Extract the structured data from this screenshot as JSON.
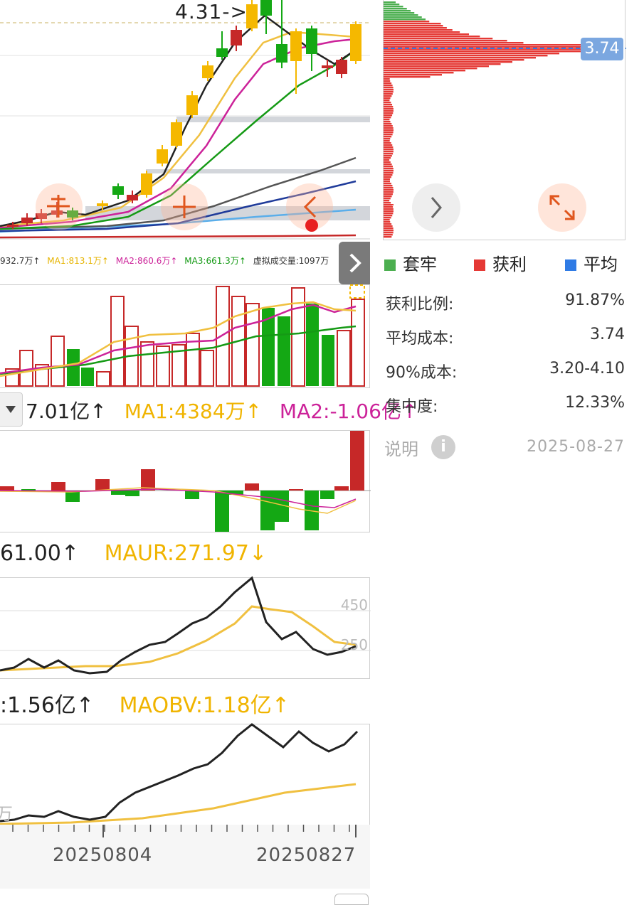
{
  "main_chart": {
    "price_marker": "4.31->",
    "ma_readout": {
      "vol": "932.7万↑",
      "ma1": "MA1:813.1万↑",
      "ma2": "MA2:860.6万↑",
      "ma3": "MA3:661.3万↑",
      "virtual": "虚拟成交量:1097万"
    }
  },
  "macd_panel": {
    "dropdown_icon": "caret-down-icon",
    "value": "7.01亿↑",
    "ma1": "MA1:4384万↑",
    "ma2": "MA2:-1.06亿↑"
  },
  "vr_panel": {
    "value": "61.00↑",
    "maur": "MAUR:271.97↓",
    "tick_450": "450",
    "tick_250": "250"
  },
  "obv_panel": {
    "value": ":1.56亿↑",
    "maobv": "MAOBV:1.18亿↑",
    "left_fragment": "万"
  },
  "x_axis": {
    "date1": "20250804",
    "date2": "20250827"
  },
  "chip_panel": {
    "avg_tag": "3.74",
    "legend": [
      {
        "label": "套牢",
        "color": "#4caf50"
      },
      {
        "label": "获利",
        "color": "#e53935"
      },
      {
        "label": "平均",
        "color": "#2f7be5"
      }
    ],
    "stats": [
      {
        "label": "获利比例:",
        "value": "91.87%"
      },
      {
        "label": "平均成本:",
        "value": "3.74"
      },
      {
        "label": "90%成本:",
        "value": "3.20-4.10"
      },
      {
        "label": "集中度:",
        "value": "12.33%"
      }
    ],
    "note_label": "说明",
    "note_icon": "info-icon",
    "date": "2025-08-27"
  },
  "controls": {
    "expand_panel_icon": "chevron-right-icon",
    "tool_icons": [
      "crosshair-icon",
      "plus-icon",
      "chevron-left-icon"
    ],
    "next_icon": "chevron-right-icon",
    "fullscreen_icon": "expand-icon"
  },
  "colors": {
    "up": "#c62828",
    "down": "#14a814",
    "yellow": "#f5b800",
    "ma_black": "#222222",
    "ma_yellow": "#f0c040",
    "ma_magenta": "#cc2299",
    "ma_green": "#159a15",
    "ma_gray": "#555555",
    "ma_navy": "#1f3b9a",
    "ma_lightblue": "#5aaeea",
    "chip_red": "#e53935",
    "chip_green": "#4caf50",
    "avg_blue": "#2f7be5"
  }
}
